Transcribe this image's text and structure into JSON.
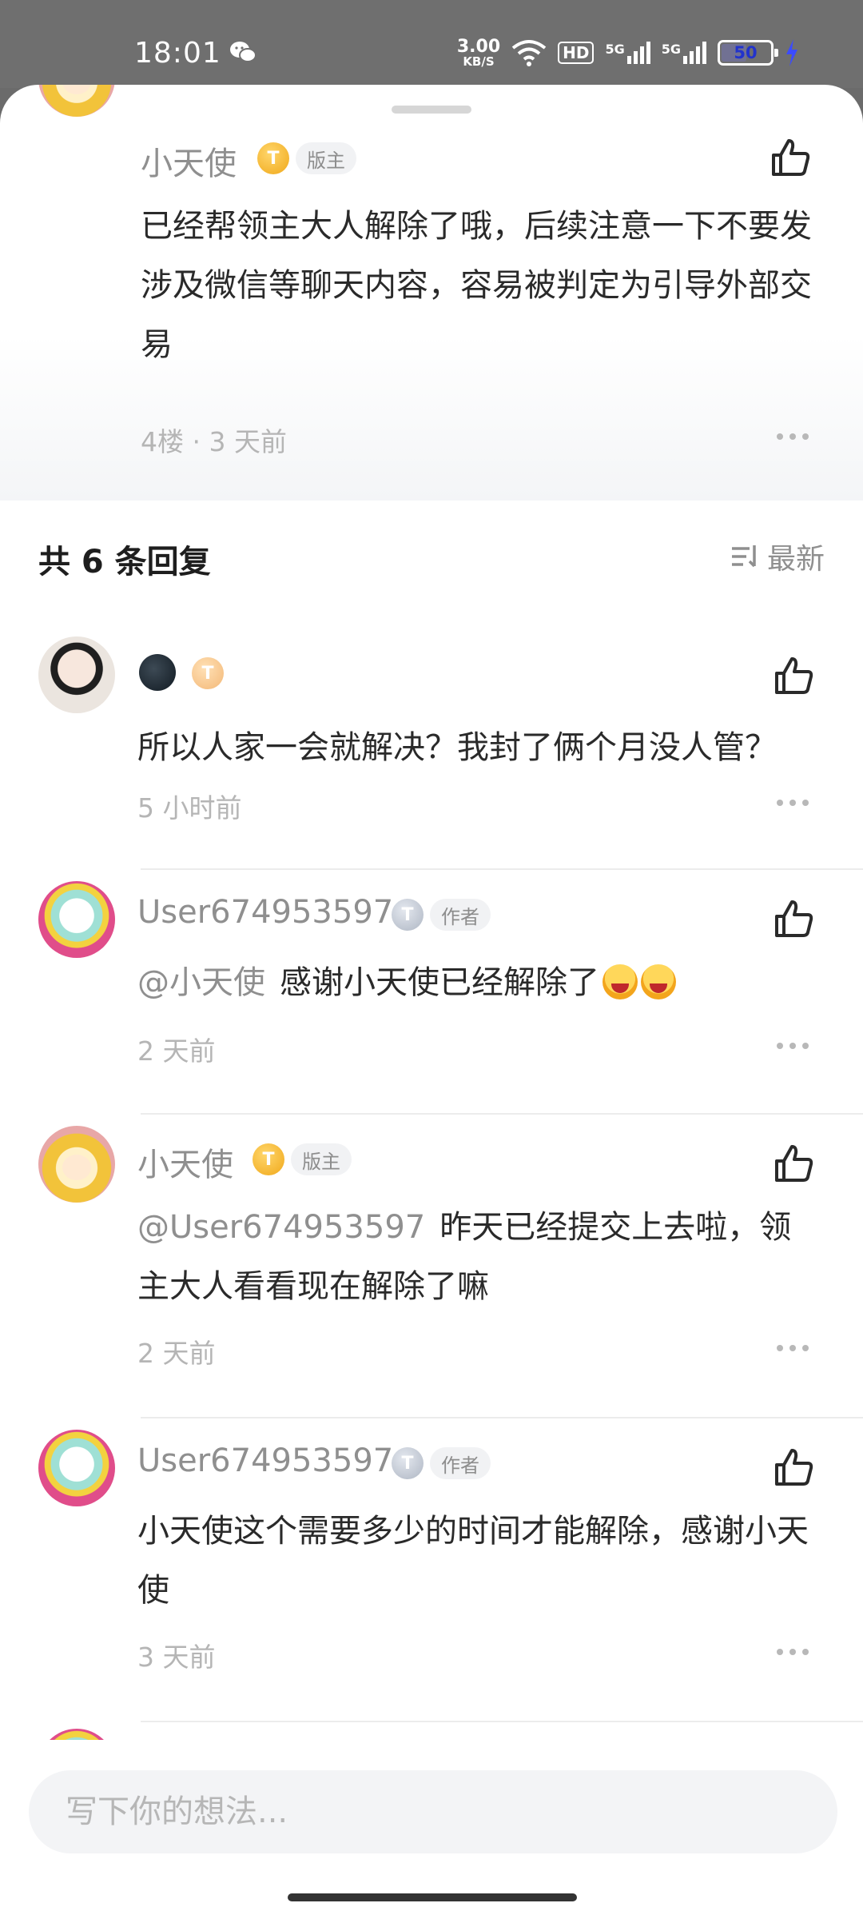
{
  "status_bar": {
    "time": "18:01",
    "net_speed_value": "3.00",
    "net_speed_unit": "KB/S",
    "hd_label": "HD",
    "sim1": "5G",
    "sim2": "5G",
    "battery": "50"
  },
  "main_comment": {
    "username": "小天使",
    "level": "T",
    "tag": "版主",
    "text": "已经帮领主大人解除了哦，后续注意一下不要发涉及微信等聊天内容，容易被判定为引导外部交易",
    "meta": "4楼 · 3 天前"
  },
  "replies_header": {
    "title": "共 6 条回复",
    "sort_label": "最新"
  },
  "replies": [
    {
      "username": "",
      "level": "T",
      "mention": "",
      "text": "所以人家一会就解决？我封了俩个月没人管？",
      "time": "5 小时前"
    },
    {
      "username": "User674953597",
      "level": "T",
      "tag": "作者",
      "mention": "@小天使",
      "text": "感谢小天使已经解除了",
      "time": "2 天前"
    },
    {
      "username": "小天使",
      "level": "T",
      "tag": "版主",
      "mention": "@User674953597",
      "text": "昨天已经提交上去啦，领主大人看看现在解除了嘛",
      "time": "2 天前"
    },
    {
      "username": "User674953597",
      "level": "T",
      "tag": "作者",
      "mention": "",
      "text": "小天使这个需要多少的时间才能解除，感谢小天使",
      "time": "3 天前"
    }
  ],
  "composer": {
    "placeholder": "写下你的想法..."
  },
  "icons": {
    "like": "thumbs-up-icon",
    "more": "more-dots-icon",
    "sort": "sort-icon"
  }
}
